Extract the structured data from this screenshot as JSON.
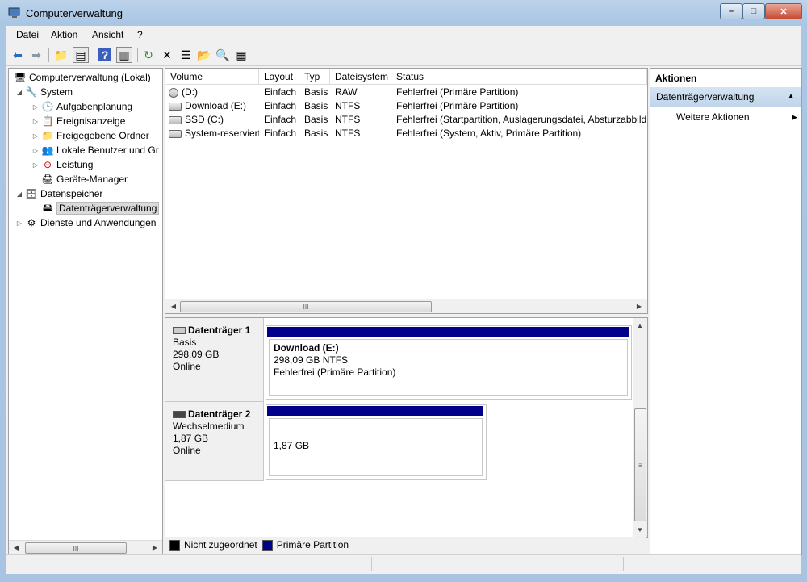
{
  "window": {
    "title": "Computerverwaltung"
  },
  "menu": [
    "Datei",
    "Aktion",
    "Ansicht",
    "?"
  ],
  "toolbar_icons": [
    "back-arrow-icon",
    "forward-arrow-icon",
    "up-folder-icon",
    "show-tree-icon",
    "help-icon",
    "show-action-pane-icon",
    "refresh-icon",
    "delete-icon",
    "properties-icon",
    "open-icon",
    "search-icon",
    "rescan-disks-icon"
  ],
  "tree": {
    "root": "Computerverwaltung (Lokal)",
    "system": "System",
    "system_children": [
      "Aufgabenplanung",
      "Ereignisanzeige",
      "Freigegebene Ordner",
      "Lokale Benutzer und Gr",
      "Leistung",
      "Geräte-Manager"
    ],
    "storage": "Datenspeicher",
    "storage_children": [
      "Datenträgerverwaltung"
    ],
    "services": "Dienste und Anwendungen"
  },
  "volumes": {
    "columns": [
      "Volume",
      "Layout",
      "Typ",
      "Dateisystem",
      "Status"
    ],
    "rows": [
      [
        "(D:)",
        "Einfach",
        "Basis",
        "RAW",
        "Fehlerfrei (Primäre Partition)"
      ],
      [
        "Download (E:)",
        "Einfach",
        "Basis",
        "NTFS",
        "Fehlerfrei (Primäre Partition)"
      ],
      [
        "SSD (C:)",
        "Einfach",
        "Basis",
        "NTFS",
        "Fehlerfrei (Startpartition, Auslagerungsdatei, Absturzabbild"
      ],
      [
        "System-reserviert",
        "Einfach",
        "Basis",
        "NTFS",
        "Fehlerfrei (System, Aktiv, Primäre Partition)"
      ]
    ],
    "scroll_thumb": "III"
  },
  "disks": [
    {
      "name": "Datenträger 1",
      "type": "Basis",
      "size": "298,09 GB",
      "state": "Online",
      "partition": {
        "title": "Download  (E:)",
        "line2": "298,09 GB NTFS",
        "line3": "Fehlerfrei (Primäre Partition)"
      }
    },
    {
      "name": "Datenträger 2",
      "type": "Wechselmedium",
      "size": "1,87 GB",
      "state": "Online",
      "partition": {
        "title": "",
        "line2": "1,87 GB",
        "line3": ""
      }
    }
  ],
  "legend": [
    {
      "label": "Nicht zugeordnet",
      "color": "#000000"
    },
    {
      "label": "Primäre Partition",
      "color": "#00008b"
    }
  ],
  "actions": {
    "header": "Aktionen",
    "section": "Datenträgerverwaltung",
    "items": [
      "Weitere Aktionen"
    ]
  }
}
